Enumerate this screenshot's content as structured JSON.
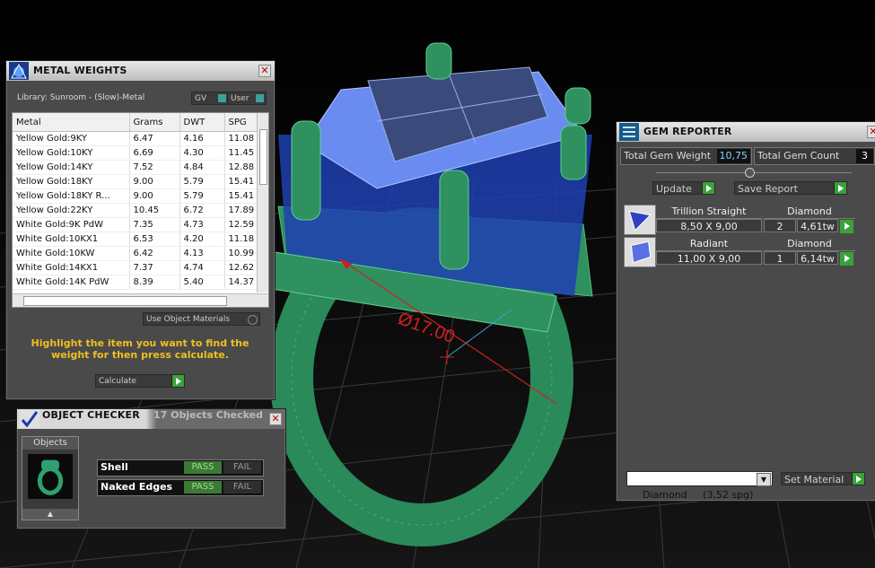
{
  "viewport": {
    "dimension_label": "Ø17.00"
  },
  "metal_weights": {
    "title": "METAL WEIGHTS",
    "library": "Library: Sunroom - (Slow)-Metal",
    "gv_label": "GV",
    "user_label": "User",
    "columns": [
      "Metal",
      "Grams",
      "DWT",
      "SPG"
    ],
    "rows": [
      [
        "Yellow Gold:9KY",
        "6.47",
        "4.16",
        "11.08"
      ],
      [
        "Yellow Gold:10KY",
        "6.69",
        "4.30",
        "11.45"
      ],
      [
        "Yellow Gold:14KY",
        "7.52",
        "4.84",
        "12.88"
      ],
      [
        "Yellow Gold:18KY",
        "9.00",
        "5.79",
        "15.41"
      ],
      [
        "Yellow Gold:18KY R...",
        "9.00",
        "5.79",
        "15.41"
      ],
      [
        "Yellow Gold:22KY",
        "10.45",
        "6.72",
        "17.89"
      ],
      [
        "White Gold:9K PdW",
        "7.35",
        "4.73",
        "12.59"
      ],
      [
        "White Gold:10KX1",
        "6.53",
        "4.20",
        "11.18"
      ],
      [
        "White Gold:10KW",
        "6.42",
        "4.13",
        "10.99"
      ],
      [
        "White Gold:14KX1",
        "7.37",
        "4.74",
        "12.62"
      ],
      [
        "White Gold:14K PdW",
        "8.39",
        "5.40",
        "14.37"
      ]
    ],
    "use_object_materials": "Use Object Materials",
    "hint": "Highlight the item you want to find the weight for then press calculate.",
    "calculate_label": "Calculate"
  },
  "object_checker": {
    "title": "OBJECT CHECKER",
    "status": "17  Objects Checked",
    "objects_label": "Objects",
    "checks": [
      {
        "name": "Shell",
        "pass": "PASS",
        "fail": "FAIL"
      },
      {
        "name": "Naked Edges",
        "pass": "PASS",
        "fail": "FAIL"
      }
    ]
  },
  "gem_reporter": {
    "title": "GEM REPORTER",
    "total_weight_label": "Total Gem Weight",
    "total_weight_value": "10,75",
    "total_count_label": "Total Gem Count",
    "total_count_value": "3",
    "update_label": "Update",
    "save_report_label": "Save Report",
    "gems": [
      {
        "cut": "Trillion Straight",
        "material": "Diamond",
        "size": "8,50 X 9,00",
        "count": "2",
        "weight": "4,61tw"
      },
      {
        "cut": "Radiant",
        "material": "Diamond",
        "size": "11,00 X 9,00",
        "count": "1",
        "weight": "6,14tw"
      }
    ],
    "material_select": "Diamond     (3,52 spg)",
    "set_material_label": "Set Material"
  }
}
